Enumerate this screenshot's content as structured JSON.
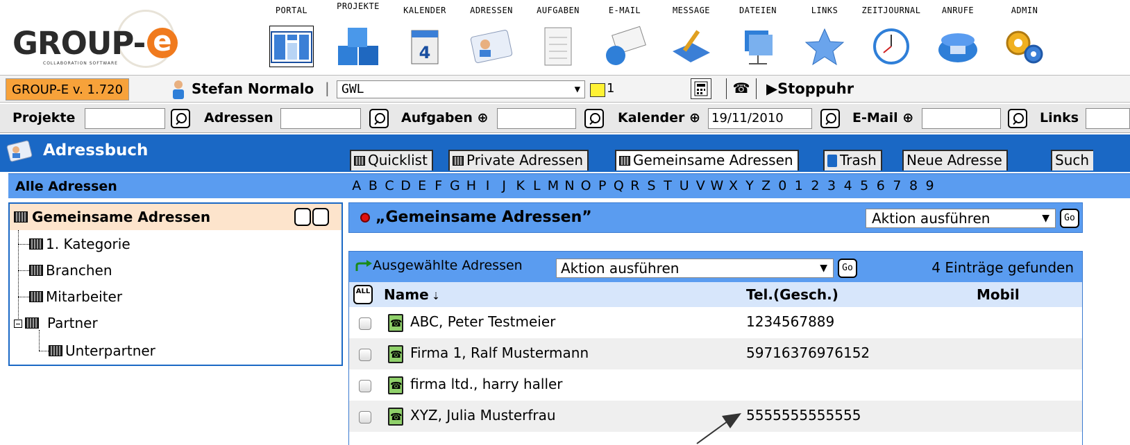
{
  "app": {
    "logo_text": "GROUP-e",
    "logo_tagline": "COLLABORATION SOFTWARE"
  },
  "nav": [
    {
      "label": "PORTAL",
      "icon": "portal-icon"
    },
    {
      "label": "PROJEKTE",
      "icon": "projects-icon"
    },
    {
      "label": "KALENDER",
      "icon": "calendar-icon"
    },
    {
      "label": "ADRESSEN",
      "icon": "addressbook-icon"
    },
    {
      "label": "AUFGABEN",
      "icon": "tasks-icon"
    },
    {
      "label": "E-MAIL",
      "icon": "email-icon"
    },
    {
      "label": "MESSAGE",
      "icon": "message-icon"
    },
    {
      "label": "DATEIEN",
      "icon": "files-icon"
    },
    {
      "label": "LINKS",
      "icon": "star-icon"
    },
    {
      "label": "ZEITJOURNAL",
      "icon": "clock-icon"
    },
    {
      "label": "ANRUFE",
      "icon": "telephone-icon"
    },
    {
      "label": "ADMIN",
      "icon": "gears-icon"
    }
  ],
  "status": {
    "version": "GROUP-E v. 1.720",
    "user": "Stefan Normalo",
    "separator": "|",
    "group": "GWL",
    "notes_count": "1",
    "phone_glyph": "☎",
    "stopwatch": "Stoppuhr"
  },
  "search": {
    "projects_label": "Projekte",
    "projects_value": "",
    "addresses_label": "Adressen",
    "addresses_value": "",
    "tasks_label": "Aufgaben ⊕",
    "tasks_value": "",
    "calendar_label": "Kalender ⊕",
    "calendar_value": "19/11/2010",
    "email_label": "E-Mail ⊕",
    "email_value": "",
    "links_label": "Links"
  },
  "module": {
    "title": "Adressbuch",
    "tabs": [
      {
        "label": "Quicklist"
      },
      {
        "label": "Private Adressen"
      },
      {
        "label": "Gemeinsame Adressen"
      },
      {
        "label": "Trash"
      },
      {
        "label": "Neue Adresse"
      },
      {
        "label": "Such"
      }
    ]
  },
  "alpha": {
    "title": "Alle Adressen",
    "letters": [
      "A",
      "B",
      "C",
      "D",
      "E",
      "F",
      "G",
      "H",
      "I",
      "J",
      "K",
      "L",
      "M",
      "N",
      "O",
      "P",
      "Q",
      "R",
      "S",
      "T",
      "U",
      "V",
      "W",
      "X",
      "Y",
      "Z",
      "0",
      "1",
      "2",
      "3",
      "4",
      "5",
      "6",
      "7",
      "8",
      "9"
    ]
  },
  "tree": {
    "root": "Gemeinsame Adressen",
    "items": [
      {
        "label": "1. Kategorie"
      },
      {
        "label": "Branchen"
      },
      {
        "label": "Mitarbeiter"
      },
      {
        "label": "Partner"
      },
      {
        "label": "Unterpartner"
      }
    ]
  },
  "list": {
    "title": "„Gemeinsame Adressen”",
    "action_select": "Aktion ausführen",
    "go_label": "Go",
    "selected_label": "Ausgewählte Adressen",
    "selected_action": "Aktion ausführen",
    "found": "4 Einträge gefunden",
    "all_label": "ALL",
    "columns": {
      "name": "Name",
      "tel": "Tel.(Gesch.)",
      "mobile": "Mobil"
    },
    "rows": [
      {
        "name": "ABC, Peter Testmeier",
        "tel": "1234567889",
        "mobile": ""
      },
      {
        "name": "Firma 1, Ralf Mustermann",
        "tel": "59716376976152",
        "mobile": ""
      },
      {
        "name": "firma ltd., harry haller",
        "tel": "",
        "mobile": ""
      },
      {
        "name": "XYZ, Julia Musterfrau",
        "tel": "5555555555555",
        "mobile": ""
      }
    ]
  },
  "colors": {
    "brand_orange": "#f07a1d",
    "header_blue": "#1a68c5",
    "bar_blue": "#5a9cf0",
    "version_bg": "#f7a23a",
    "tree_head_bg": "#fde4cc"
  }
}
